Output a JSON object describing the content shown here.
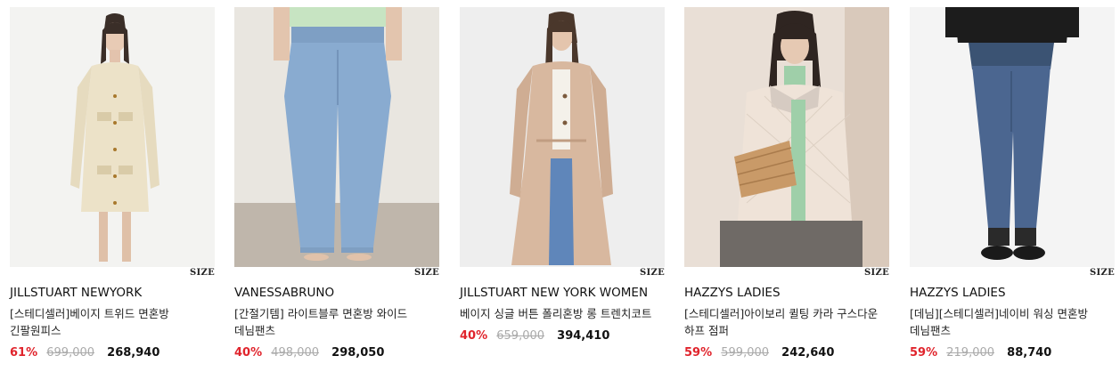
{
  "size_label": "SIZE",
  "colors": {
    "discount": "#e0242c",
    "original_price": "#aaaaaa"
  },
  "products": [
    {
      "brand": "JILLSTUART NEWYORK",
      "name": "[스테디셀러]베이지 트위드 면혼방 긴팔원피스",
      "discount": "61%",
      "original_price": "699,000",
      "sale_price": "268,940"
    },
    {
      "brand": "VANESSABRUNO",
      "name": "[간절기템] 라이트블루 면혼방 와이드 데님팬츠",
      "discount": "40%",
      "original_price": "498,000",
      "sale_price": "298,050"
    },
    {
      "brand": "JILLSTUART NEW YORK WOMEN",
      "name": "베이지 싱글 버튼 폴리혼방 롱 트렌치코트",
      "discount": "40%",
      "original_price": "659,000",
      "sale_price": "394,410"
    },
    {
      "brand": "HAZZYS LADIES",
      "name": "[스테디셀러]아이보리 퀼팅 카라 구스다운 하프 점퍼",
      "discount": "59%",
      "original_price": "599,000",
      "sale_price": "242,640"
    },
    {
      "brand": "HAZZYS LADIES",
      "name": "[데님][스테디셀러]네이비 워싱 면혼방 데님팬츠",
      "discount": "59%",
      "original_price": "219,000",
      "sale_price": "88,740"
    }
  ]
}
